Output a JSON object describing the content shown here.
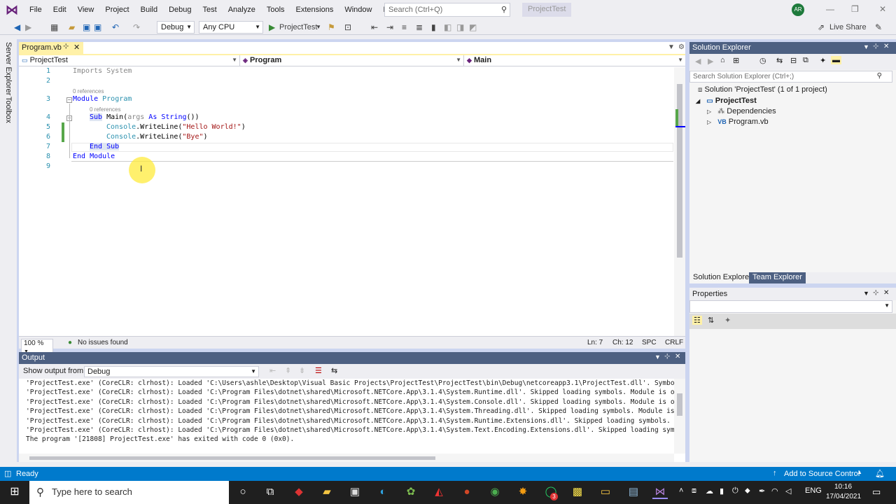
{
  "menubar": {
    "items": [
      "File",
      "Edit",
      "View",
      "Project",
      "Build",
      "Debug",
      "Test",
      "Analyze",
      "Tools",
      "Extensions",
      "Window",
      "Help"
    ],
    "search_placeholder": "Search (Ctrl+Q)",
    "project_title": "ProjectTest",
    "avatar_initials": "AR"
  },
  "toolbar": {
    "config": "Debug",
    "platform": "Any CPU",
    "start_target": "ProjectTest",
    "live_share": "Live Share"
  },
  "side_strip": {
    "server_explorer": "Server Explorer",
    "toolbox": "Toolbox"
  },
  "editor": {
    "tab_label": "Program.vb",
    "nav": {
      "project": "ProjectTest",
      "type": "Program",
      "member": "Main"
    },
    "line_numbers": [
      "1",
      "2",
      "3",
      "4",
      "5",
      "6",
      "7",
      "8",
      "9"
    ],
    "ref_hints": [
      "0 references",
      "0 references"
    ],
    "lines": {
      "l1_kw": "Imports",
      "l1_rest": " System",
      "l3_kw": "Module",
      "l3_name": " Program",
      "l4_kw": "Sub",
      "l4_name": " Main(",
      "l4_arg": "args",
      "l4_as": " As",
      "l4_type": " String",
      "l4_close": "())",
      "l5_obj": "Console",
      "l5_method": ".WriteLine(",
      "l5_str": "\"Hello World!\"",
      "l5_close": ")",
      "l6_obj": "Console",
      "l6_method": ".WriteLine(",
      "l6_str": "\"Bye\"",
      "l6_close": ")",
      "l7": "End Sub",
      "l8": "End Module"
    },
    "status": {
      "zoom": "100 %",
      "issues": "No issues found",
      "line": "Ln: 7",
      "col": "Ch: 12",
      "ws": "SPC",
      "eol": "CRLF"
    }
  },
  "output": {
    "title": "Output",
    "show_from_label": "Show output from:",
    "source": "Debug",
    "lines": [
      "'ProjectTest.exe' (CoreCLR: clrhost): Loaded 'C:\\Users\\ashle\\Desktop\\Visual Basic Projects\\ProjectTest\\ProjectTest\\bin\\Debug\\netcoreapp3.1\\ProjectTest.dll'. Symbols loaded.",
      "'ProjectTest.exe' (CoreCLR: clrhost): Loaded 'C:\\Program Files\\dotnet\\shared\\Microsoft.NETCore.App\\3.1.4\\System.Runtime.dll'. Skipped loading symbols. Module is optimized and",
      "'ProjectTest.exe' (CoreCLR: clrhost): Loaded 'C:\\Program Files\\dotnet\\shared\\Microsoft.NETCore.App\\3.1.4\\System.Console.dll'. Skipped loading symbols. Module is optimized and",
      "'ProjectTest.exe' (CoreCLR: clrhost): Loaded 'C:\\Program Files\\dotnet\\shared\\Microsoft.NETCore.App\\3.1.4\\System.Threading.dll'. Skipped loading symbols. Module is optimized a",
      "'ProjectTest.exe' (CoreCLR: clrhost): Loaded 'C:\\Program Files\\dotnet\\shared\\Microsoft.NETCore.App\\3.1.4\\System.Runtime.Extensions.dll'. Skipped loading symbols. Module is op",
      "'ProjectTest.exe' (CoreCLR: clrhost): Loaded 'C:\\Program Files\\dotnet\\shared\\Microsoft.NETCore.App\\3.1.4\\System.Text.Encoding.Extensions.dll'. Skipped loading symbols. Module",
      "The program '[21808] ProjectTest.exe' has exited with code 0 (0x0)."
    ]
  },
  "solution_explorer": {
    "title": "Solution Explorer",
    "search_placeholder": "Search Solution Explorer (Ctrl+;)",
    "solution_label": "Solution 'ProjectTest' (1 of 1 project)",
    "project": "ProjectTest",
    "items": [
      "Dependencies",
      "Program.vb"
    ],
    "tabs": [
      "Solution Explorer",
      "Team Explorer"
    ]
  },
  "properties": {
    "title": "Properties"
  },
  "statusbar": {
    "ready": "Ready",
    "source_control": "Add to Source Control"
  },
  "taskbar": {
    "search_placeholder": "Type here to search",
    "language": "ENG",
    "time": "10:16",
    "date": "17/04/2021",
    "whatsapp_badge": "3"
  },
  "colors": {
    "accent": "#007acc",
    "panel_title": "#4d6082",
    "tab_active": "#fff1a8",
    "keyword": "#0000ff",
    "string": "#a31515",
    "type": "#2b91af"
  }
}
